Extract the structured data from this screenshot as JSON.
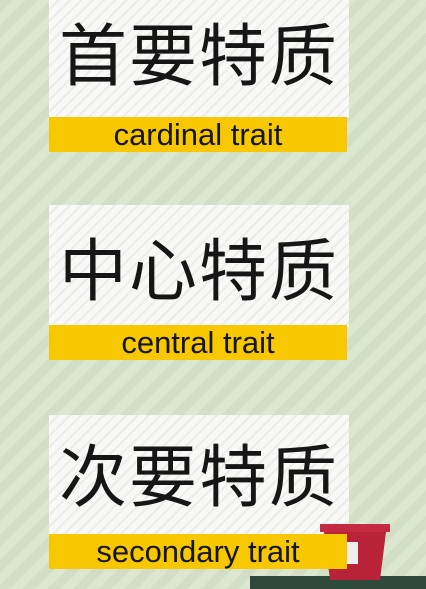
{
  "traits": [
    {
      "chinese": "首要特质",
      "english": "cardinal trait"
    },
    {
      "chinese": "中心特质",
      "english": "central trait"
    },
    {
      "chinese": "次要特质",
      "english": "secondary trait"
    }
  ],
  "colors": {
    "background": "#d2dfc6",
    "card": "#f6f6f4",
    "label_bg": "#f7c700",
    "text": "#161616",
    "cup_red": "#b8233a"
  },
  "icons": [
    "cup-icon"
  ]
}
